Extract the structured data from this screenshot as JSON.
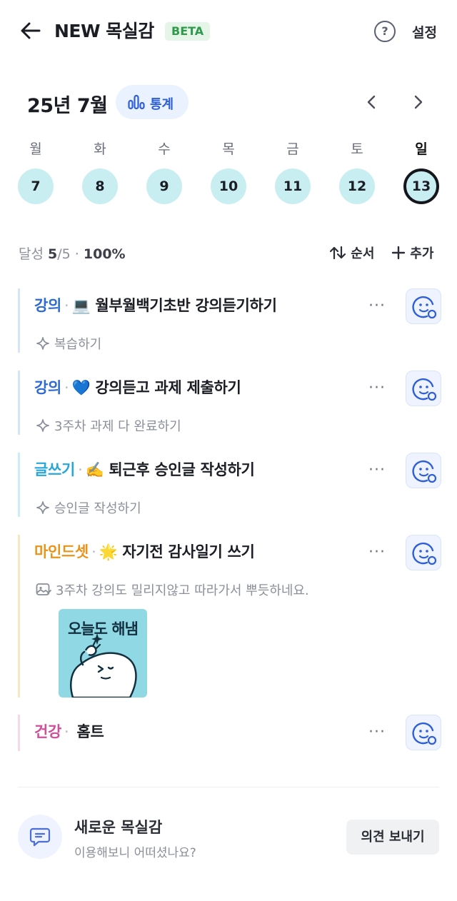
{
  "header": {
    "title": "NEW 목실감",
    "badge": "BETA",
    "help_label": "?",
    "settings_label": "설정"
  },
  "calendar": {
    "month_label": "25년 7월",
    "stats_label": "통계",
    "weekdays": [
      "월",
      "화",
      "수",
      "목",
      "금",
      "토",
      "일"
    ],
    "days": [
      "7",
      "8",
      "9",
      "10",
      "11",
      "12",
      "13"
    ],
    "selected_index": 6
  },
  "summary": {
    "label": "달성",
    "done": "5",
    "total": "/5",
    "separator": "·",
    "percent": "100%",
    "sort_label": "순서",
    "add_label": "추가"
  },
  "tasks": [
    {
      "category": "강의",
      "category_color": "#2e6ad6",
      "bar_color": "#d7e3fa",
      "emoji": "💻",
      "title": "월부월백기초반 강의듣기하기",
      "sub": "복습하기",
      "sub_icon": "sparkle-icon"
    },
    {
      "category": "강의",
      "category_color": "#2e6ad6",
      "bar_color": "#d7e3fa",
      "emoji": "💙",
      "title": "강의듣고 과제 제출하기",
      "sub": "3주차 과제 다 완료하기",
      "sub_icon": "sparkle-icon"
    },
    {
      "category": "글쓰기",
      "category_color": "#27a7d8",
      "bar_color": "#c9eef6",
      "emoji": "✍️",
      "title": "퇴근후 승인글 작성하기",
      "sub": "승인글 작성하기",
      "sub_icon": "sparkle-icon"
    },
    {
      "category": "마인드셋",
      "category_color": "#e8941a",
      "bar_color": "#fce6c2",
      "emoji": "🌟",
      "title": "자기전 감사일기 쓰기",
      "sub": "3주차 강의도 밀리지않고 따라가서 뿌듯하네요.",
      "sub_icon": "image-icon",
      "sticker_text": "오늘도 해냄"
    },
    {
      "category": "건강",
      "category_color": "#d04f9a",
      "bar_color": "#f8d7e8",
      "emoji": "",
      "title": "홈트",
      "sub": "",
      "sub_icon": ""
    }
  ],
  "more_label": "···",
  "feedback": {
    "title": "새로운 목실감",
    "subtitle": "이용해보니 어떠셨나요?",
    "button_label": "의견 보내기"
  }
}
